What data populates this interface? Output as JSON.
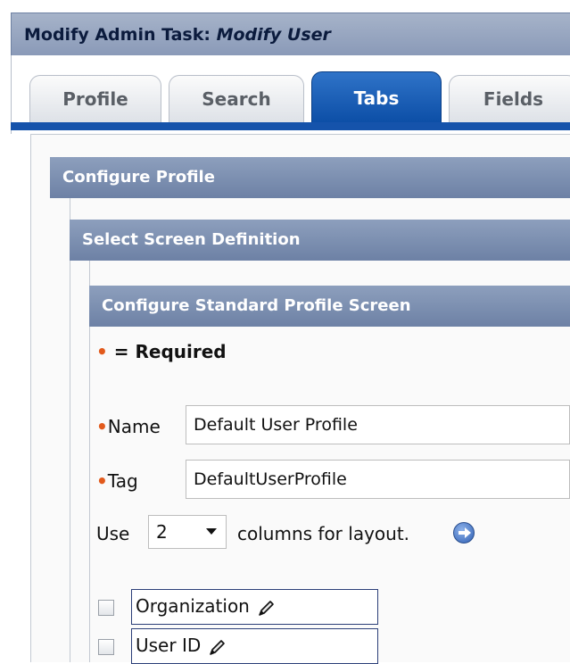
{
  "title": {
    "prefix": "Modify Admin Task: ",
    "task": "Modify User"
  },
  "tabs": [
    {
      "label": "Profile",
      "active": false
    },
    {
      "label": "Search",
      "active": false
    },
    {
      "label": "Tabs",
      "active": true
    },
    {
      "label": "Fields",
      "active": false
    }
  ],
  "sections": {
    "configure_profile": "Configure Profile",
    "select_screen_definition": "Select Screen Definition",
    "configure_standard_profile_screen": "Configure Standard Profile Screen"
  },
  "required_legend": {
    "marker": "•",
    "text": " = Required"
  },
  "fields": {
    "name": {
      "label": "Name",
      "value": "Default User Profile"
    },
    "tag": {
      "label": "Tag",
      "value": "DefaultUserProfile"
    }
  },
  "layout": {
    "prefix": "Use",
    "columns": "2",
    "suffix": "columns for layout."
  },
  "field_items": [
    {
      "label": "Organization"
    },
    {
      "label": "User ID"
    }
  ],
  "colors": {
    "accent": "#1553ab",
    "required": "#e25a1c",
    "header": "#7a8db0"
  }
}
